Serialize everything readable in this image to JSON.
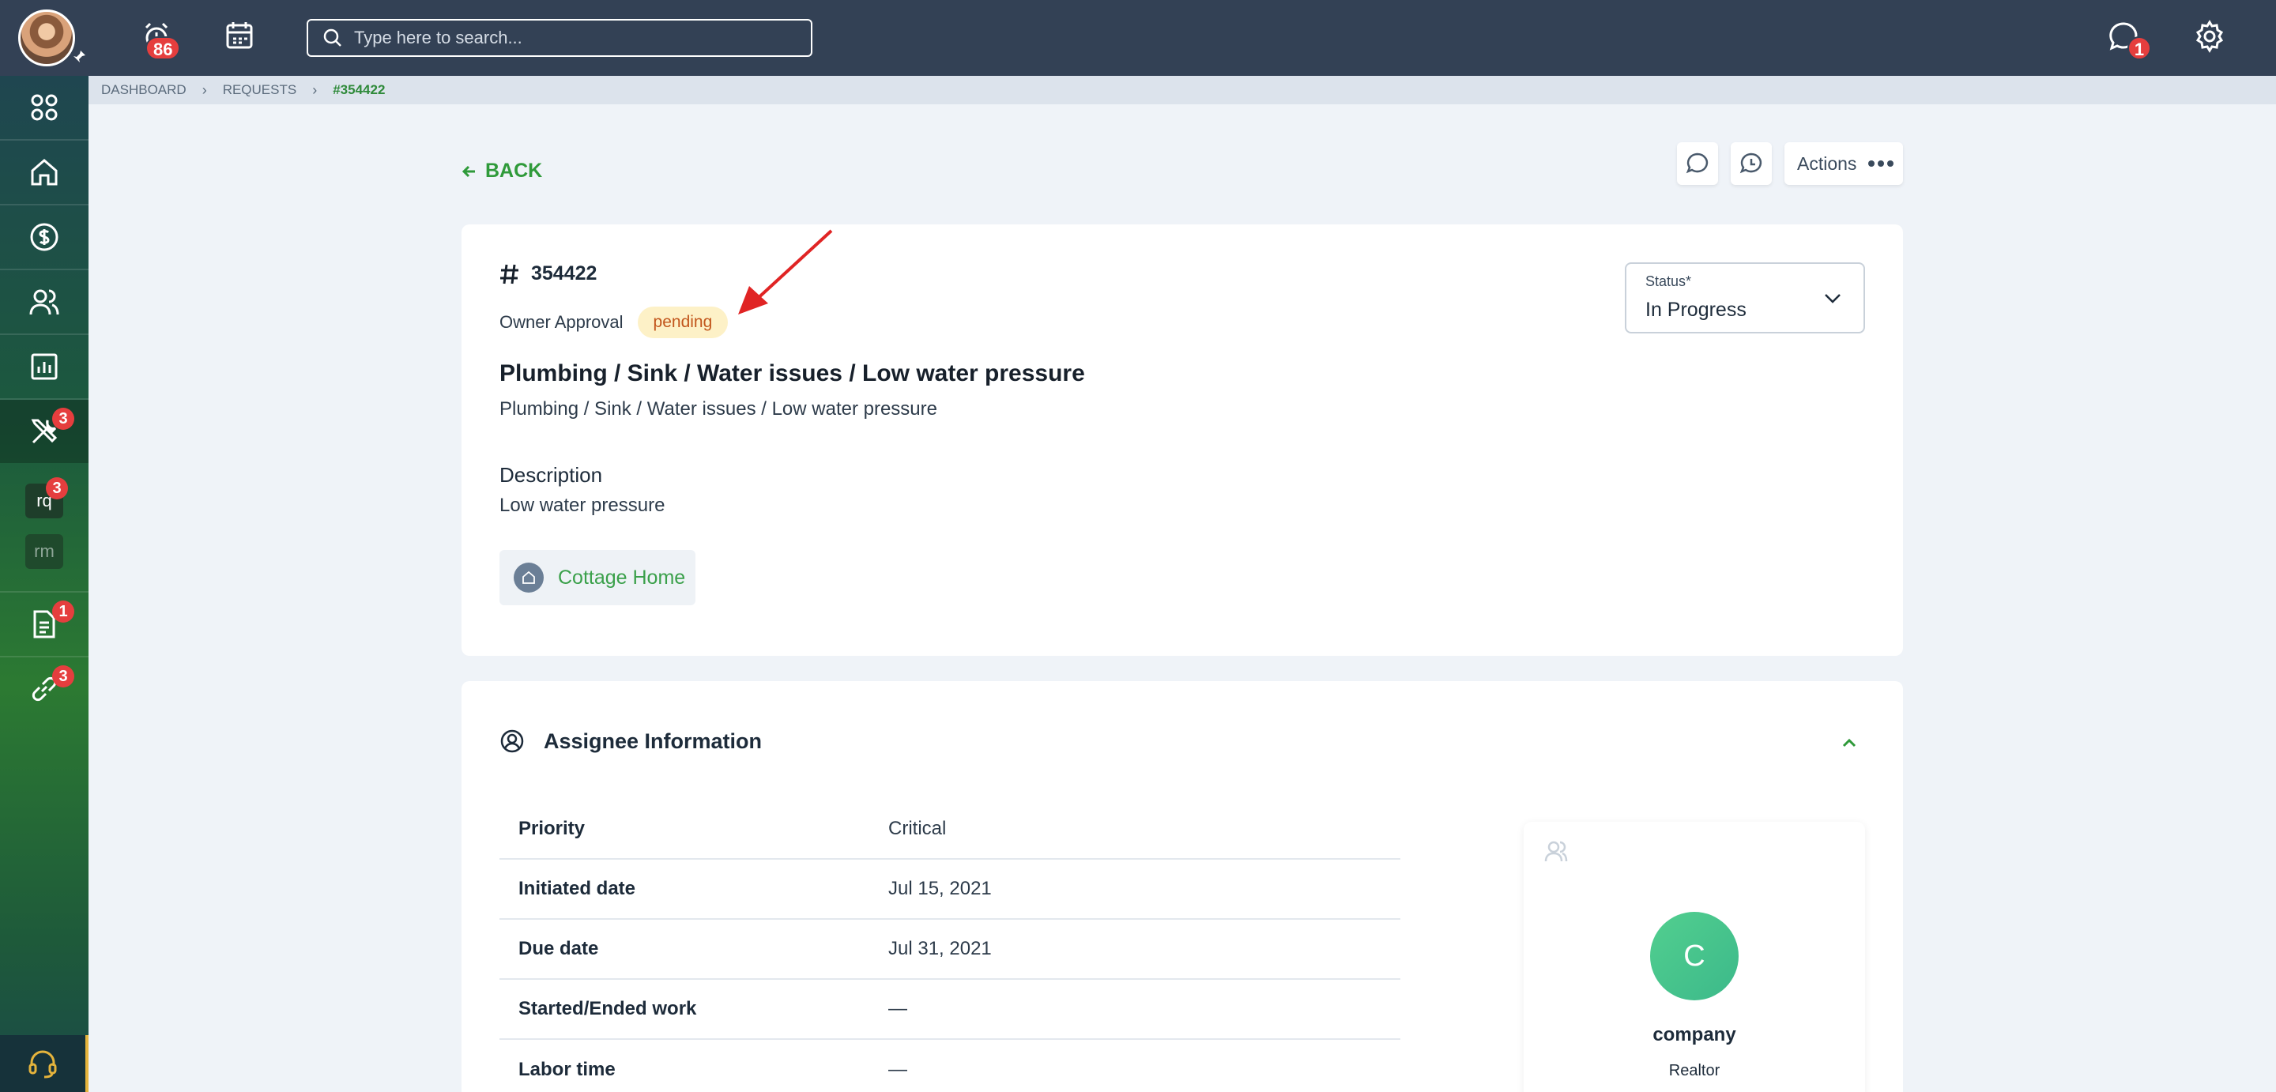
{
  "topbar": {
    "search_placeholder": "Type here to search...",
    "alerts_count": "86",
    "messages_count": "1"
  },
  "sidebar": {
    "maintenance_badge": "3",
    "rq_label": "rq",
    "rq_badge": "3",
    "rm_label": "rm",
    "documents_badge": "1",
    "links_badge": "3"
  },
  "breadcrumb": [
    "DASHBOARD",
    "REQUESTS",
    "#354422"
  ],
  "header": {
    "back_label": "BACK",
    "actions_label": "Actions"
  },
  "request": {
    "id": "354422",
    "owner_approval_label": "Owner Approval",
    "owner_approval_status": "pending",
    "title": "Plumbing / Sink / Water issues / Low water pressure",
    "subtitle": "Plumbing / Sink / Water issues / Low water pressure",
    "description_heading": "Description",
    "description": "Low water pressure",
    "property": "Cottage Home",
    "status_label": "Status*",
    "status_value": "In Progress"
  },
  "assignee": {
    "heading": "Assignee Information",
    "rows": [
      {
        "key": "Priority",
        "value": "Critical"
      },
      {
        "key": "Initiated date",
        "value": "Jul 15, 2021"
      },
      {
        "key": "Due date",
        "value": "Jul 31, 2021"
      },
      {
        "key": "Started/Ended work",
        "value": "—"
      },
      {
        "key": "Labor time",
        "value": "—"
      }
    ],
    "company_initial": "C",
    "company_name": "company",
    "company_role": "Realtor"
  },
  "colors": {
    "topbar": "#334155",
    "accent_green": "#2f9a3a",
    "badge_red": "#e53e3e",
    "pending_bg": "#fdf1c7",
    "pending_text": "#c2561c"
  }
}
